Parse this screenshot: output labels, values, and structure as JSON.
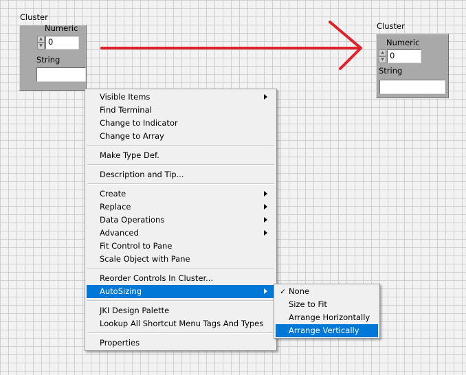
{
  "left_cluster": {
    "title": "Cluster",
    "numeric_label": "Numeric",
    "numeric_value": "0",
    "string_label": "String",
    "string_value": ""
  },
  "right_cluster": {
    "title": "Cluster",
    "numeric_label": "Numeric",
    "numeric_value": "0",
    "string_label": "String",
    "string_value": ""
  },
  "arrow_color": "#e0202a",
  "context_menu": {
    "groups": [
      [
        {
          "label": "Visible Items",
          "submenu": true
        },
        {
          "label": "Find Terminal",
          "submenu": false
        },
        {
          "label": "Change to Indicator",
          "submenu": false
        },
        {
          "label": "Change to Array",
          "submenu": false
        }
      ],
      [
        {
          "label": "Make Type Def.",
          "submenu": false
        }
      ],
      [
        {
          "label": "Description and Tip...",
          "submenu": false
        }
      ],
      [
        {
          "label": "Create",
          "submenu": true
        },
        {
          "label": "Replace",
          "submenu": true
        },
        {
          "label": "Data Operations",
          "submenu": true
        },
        {
          "label": "Advanced",
          "submenu": true
        },
        {
          "label": "Fit Control to Pane",
          "submenu": false
        },
        {
          "label": "Scale Object with Pane",
          "submenu": false
        }
      ],
      [
        {
          "label": "Reorder Controls In Cluster...",
          "submenu": false
        },
        {
          "label": "AutoSizing",
          "submenu": true,
          "highlighted": true
        }
      ],
      [
        {
          "label": "JKI Design Palette",
          "submenu": false
        },
        {
          "label": "Lookup All Shortcut Menu Tags And Types",
          "submenu": false
        }
      ],
      [
        {
          "label": "Properties",
          "submenu": false
        }
      ]
    ]
  },
  "autosizing_submenu": {
    "items": [
      {
        "label": "None",
        "checked": true
      },
      {
        "label": "Size to Fit",
        "checked": false
      },
      {
        "label": "Arrange Horizontally",
        "checked": false
      },
      {
        "label": "Arrange Vertically",
        "checked": false,
        "highlighted": true
      }
    ],
    "check_glyph": "✓"
  },
  "highlight_color": "#0078d7"
}
